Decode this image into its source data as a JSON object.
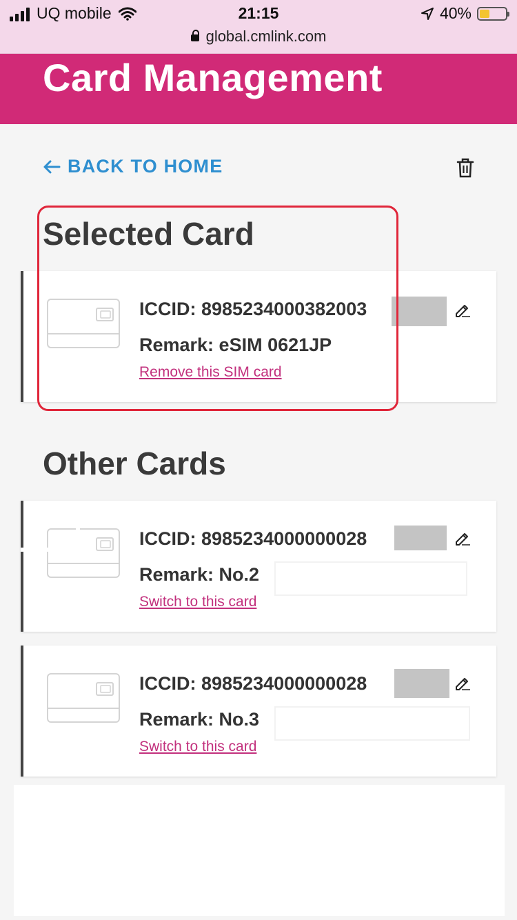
{
  "status_bar": {
    "carrier": "UQ mobile",
    "time": "21:15",
    "battery_percent": "40%",
    "battery_level": 0.4,
    "url": "global.cmlink.com"
  },
  "header": {
    "title": "Card Management"
  },
  "nav": {
    "back_label": "BACK TO HOME"
  },
  "selected": {
    "section_title": "Selected Card",
    "card": {
      "iccid": "ICCID: 8985234000382003",
      "remark": "Remark: eSIM 0621JP",
      "action": "Remove this SIM card"
    }
  },
  "others": {
    "section_title": "Other Cards",
    "cards": [
      {
        "iccid": "ICCID: 8985234000000028",
        "remark": "Remark: No.2",
        "action": "Switch to this card"
      },
      {
        "iccid": "ICCID: 8985234000000028",
        "remark": "Remark: No.3",
        "action": "Switch to this card"
      }
    ]
  },
  "colors": {
    "accent": "#d12a77",
    "link": "#2f8fd0",
    "card_link": "#c2307d",
    "highlight": "#e0263a"
  },
  "icons": [
    "signal-icon",
    "wifi-icon",
    "location-arrow-icon",
    "battery-icon",
    "lock-icon",
    "arrow-left-icon",
    "trash-icon",
    "sim-card-icon",
    "edit-icon"
  ]
}
